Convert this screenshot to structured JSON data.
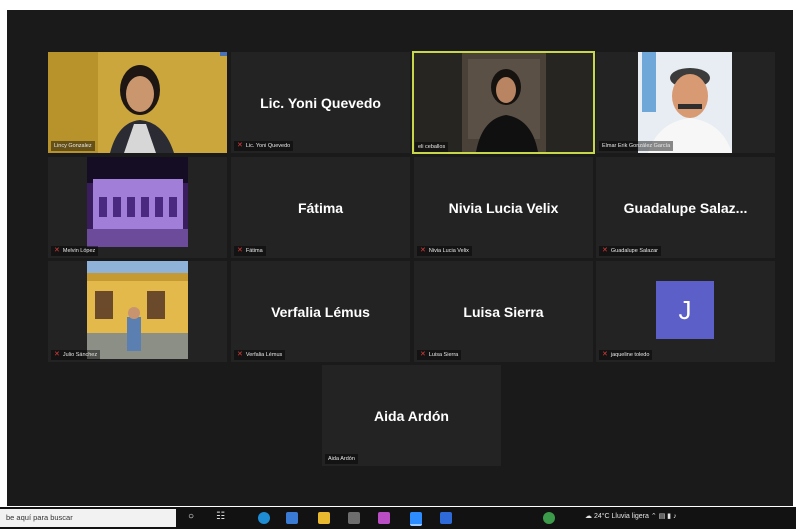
{
  "participants": [
    {
      "display": "",
      "caption": "Lincy Gonzalez",
      "muted": false,
      "video": "woman-yellow"
    },
    {
      "display": "Lic. Yoni Quevedo",
      "caption": "Lic. Yoni Quevedo",
      "muted": true
    },
    {
      "display": "",
      "caption": "eli ceballos",
      "muted": false,
      "video": "woman-dark",
      "active": true
    },
    {
      "display": "",
      "caption": "Elmar Erik González García",
      "muted": false,
      "video": "man-white"
    },
    {
      "display": "",
      "caption": "Melvin López",
      "muted": true,
      "video": "purple-building"
    },
    {
      "display": "Fátima",
      "caption": "Fátima",
      "muted": true
    },
    {
      "display": "Nivia Lucia Velix",
      "caption": "Nivia Lucia Velix",
      "muted": true
    },
    {
      "display": "Guadalupe  Salaz...",
      "caption": "Guadalupe Salazar",
      "muted": true
    },
    {
      "display": "",
      "caption": "Julio Sánchez",
      "muted": true,
      "video": "yellow-building"
    },
    {
      "display": "Verfalia Lémus",
      "caption": "Verfalia Lémus",
      "muted": true
    },
    {
      "display": "Luisa Sierra",
      "caption": "Luisa Sierra",
      "muted": true
    },
    {
      "display": "",
      "caption": "jaqueline toledo",
      "muted": true,
      "avatar": "J"
    },
    {
      "display": "Aida Ardón",
      "caption": "Aida Ardón",
      "muted": false
    }
  ],
  "taskbar": {
    "search_placeholder": "be aquí para buscar",
    "weather": "24°C  Lluvia ligera"
  },
  "colors": {
    "meeting_bg": "#1a1a1a",
    "tile_bg": "#232323",
    "active_border": "#c8d64a",
    "avatar_bg": "#5b5fc7",
    "mute_red": "#e23b3b"
  }
}
